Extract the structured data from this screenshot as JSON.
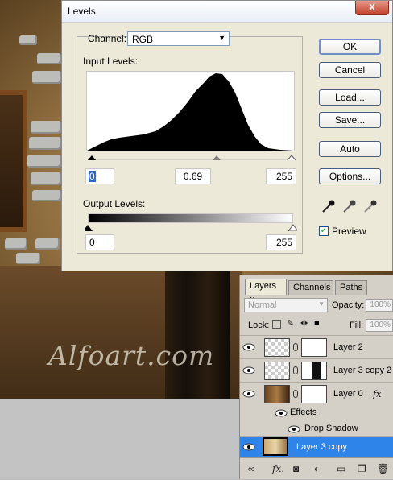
{
  "watermark": "Alfoart.com",
  "levels_dialog": {
    "title": "Levels",
    "close_glyph": "X",
    "channel_label": "Channel:",
    "channel_value": "RGB",
    "input_levels_label": "Input Levels:",
    "input_black": "0",
    "input_gamma": "0.69",
    "input_white": "255",
    "output_levels_label": "Output Levels:",
    "output_black": "0",
    "output_white": "255",
    "buttons": {
      "ok": "OK",
      "cancel": "Cancel",
      "load": "Load...",
      "save": "Save...",
      "auto": "Auto",
      "options": "Options..."
    },
    "preview_label": "Preview",
    "preview_checked": true
  },
  "layers_panel": {
    "tabs": [
      "Layers",
      "Channels",
      "Paths"
    ],
    "tab_close": "×",
    "blend_mode": "Normal",
    "opacity_label": "Opacity:",
    "opacity_value": "100%",
    "lock_label": "Lock:",
    "fill_label": "Fill:",
    "fill_value": "100%",
    "layers": [
      {
        "name": "Layer 2"
      },
      {
        "name": "Layer 3 copy 2"
      },
      {
        "name": "Layer 0",
        "fx": "fx"
      },
      {
        "name": "Effects"
      },
      {
        "name": "Drop Shadow"
      },
      {
        "name": "Layer 3 copy",
        "selected": true
      }
    ],
    "bottom_icons": [
      "link-icon",
      "fx-icon",
      "mask-icon",
      "adjustment-icon",
      "folder-icon",
      "new-layer-icon",
      "trash-icon"
    ]
  },
  "colors": {
    "dialog_bg": "#ece9d8",
    "selection_blue": "#2f84ea",
    "ok_border": "#6f8fc8"
  }
}
